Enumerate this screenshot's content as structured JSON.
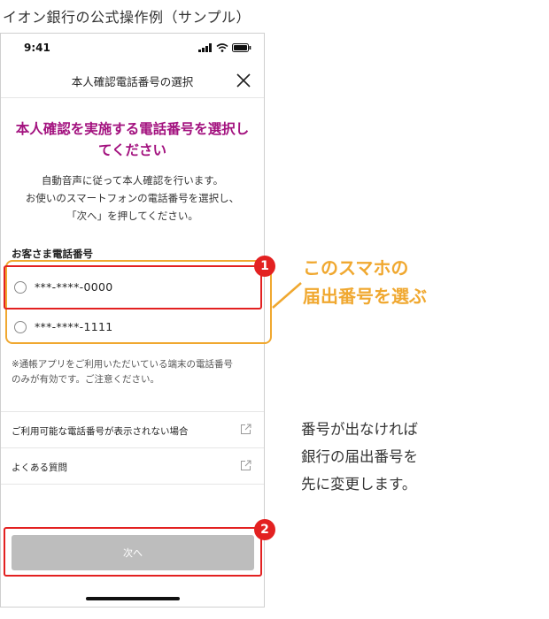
{
  "caption": "イオン銀行の公式操作例（サンプル）",
  "status_bar": {
    "time": "9:41"
  },
  "header": {
    "title": "本人確認電話番号の選択"
  },
  "headline": [
    "本人確認を実施する電話番号を選択し",
    "てください"
  ],
  "description": [
    "自動音声に従って本人確認を行います。",
    "お使いのスマートフォンの電話番号を選択し、",
    "「次へ」を押してください。"
  ],
  "phone_section": {
    "label": "お客さま電話番号",
    "options": [
      "***-****-0000",
      "***-****-1111"
    ]
  },
  "note": [
    "※通帳アプリをご利用いただいている端末の電話番号",
    "のみが有効です。ご注意ください。"
  ],
  "links": [
    {
      "label": "ご利用可能な電話番号が表示されない場合",
      "icon": "external-link-icon"
    },
    {
      "label": "よくある質問",
      "icon": "external-link-icon"
    }
  ],
  "next_button": {
    "label": "次へ"
  },
  "annotations": {
    "badge1": "1",
    "badge2": "2",
    "callout": [
      "このスマホの",
      "届出番号を選ぶ"
    ],
    "side_text": [
      "番号が出なければ",
      "銀行の届出番号を",
      "先に変更します。"
    ]
  },
  "colors": {
    "headline": "#a3127f",
    "highlight_red": "#e32121",
    "highlight_orange": "#f0a830",
    "button_disabled": "#bdbdbd"
  }
}
